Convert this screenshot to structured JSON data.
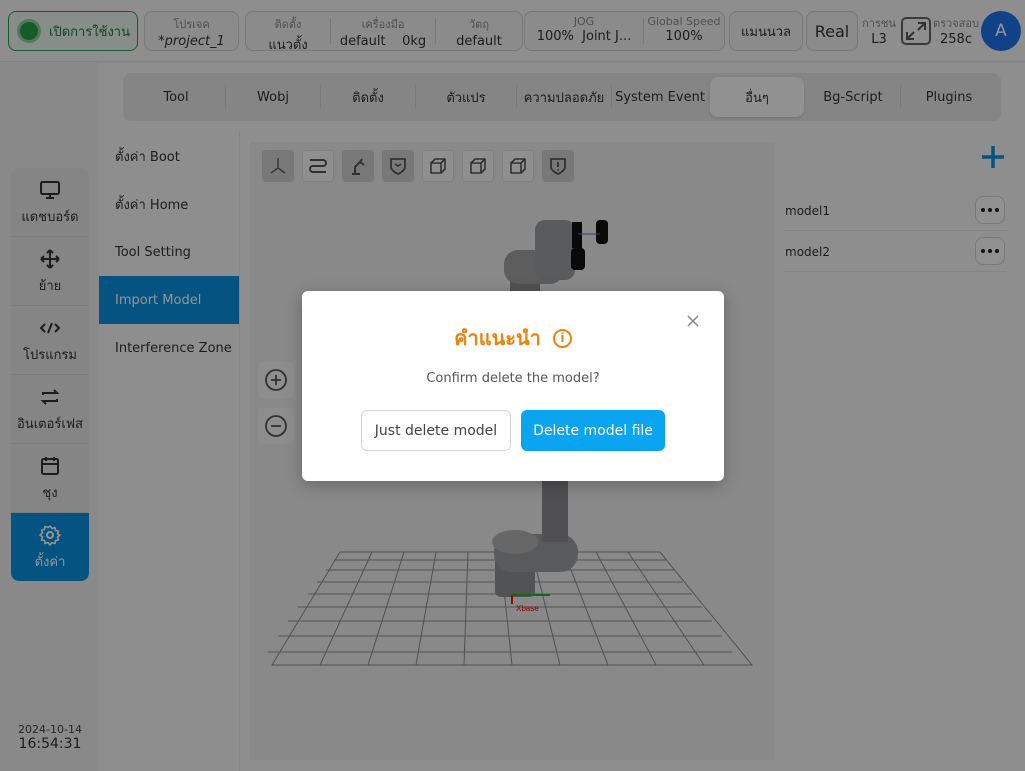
{
  "topbar": {
    "enable_label": "เปิดการใช้งาน",
    "project": {
      "label": "โปรเจค",
      "value": "*project_1"
    },
    "install": {
      "label": "ติดตั้ง",
      "value": "แนวตั้ง"
    },
    "tool": {
      "label": "เครื่องมือ",
      "value": "default",
      "weight": "0kg"
    },
    "object": {
      "label": "วัตถุ",
      "value": "default"
    },
    "jog": {
      "label": "JOG",
      "percent": "100%",
      "mode": "Joint J..."
    },
    "global_speed": {
      "label": "Global Speed",
      "value": "100%"
    },
    "manual_label": "แมนนวล",
    "real_label": "Real",
    "level": {
      "label": "การชน",
      "value": "L3"
    },
    "check": {
      "label": "ตรวจสอบ",
      "value": "258c"
    },
    "avatar_letter": "A"
  },
  "leftnav": {
    "items": [
      {
        "label": "แดชบอร์ด",
        "icon": "monitor-icon"
      },
      {
        "label": "ย้าย",
        "icon": "move-icon"
      },
      {
        "label": "โปรแกรม",
        "icon": "code-icon"
      },
      {
        "label": "อินเตอร์เฟส",
        "icon": "swap-icon"
      },
      {
        "label": "ชุง",
        "icon": "calendar-icon"
      },
      {
        "label": "ตั้งค่า",
        "icon": "gear-icon",
        "active": true
      }
    ],
    "date": "2024-10-14",
    "time": "16:54:31"
  },
  "tabs": [
    {
      "label": "Tool"
    },
    {
      "label": "Wobj"
    },
    {
      "label": "ติดตั้ง"
    },
    {
      "label": "ตัวแปร"
    },
    {
      "label": "ความปลอดภัย"
    },
    {
      "label": "System Event"
    },
    {
      "label": "อื่นๆ",
      "active": true
    },
    {
      "label": "Bg-Script"
    },
    {
      "label": "Plugins"
    }
  ],
  "submenu": [
    {
      "label": "ตั้งค่า Boot"
    },
    {
      "label": "ตั้งค่า Home"
    },
    {
      "label": "Tool Setting"
    },
    {
      "label": "Import Model",
      "active": true
    },
    {
      "label": "Interference Zone"
    }
  ],
  "viewer": {
    "axis_label": "Xbase",
    "tools": [
      "axis-view-icon",
      "path-icon",
      "robot-icon",
      "shield-icon",
      "cube-front-icon",
      "cube-side-icon",
      "cube-iso-icon",
      "warning-shield-icon"
    ]
  },
  "models": [
    {
      "name": "model1"
    },
    {
      "name": "model2"
    }
  ],
  "dialog": {
    "title": "คำแนะนำ",
    "message": "Confirm delete the model?",
    "just_delete_label": "Just delete model",
    "delete_file_label": "Delete model file"
  },
  "colors": {
    "accent": "#0a8fdc",
    "primary_button": "#0aa4f0",
    "dialog_title": "#e8850f",
    "enable_green": "#24a148"
  }
}
